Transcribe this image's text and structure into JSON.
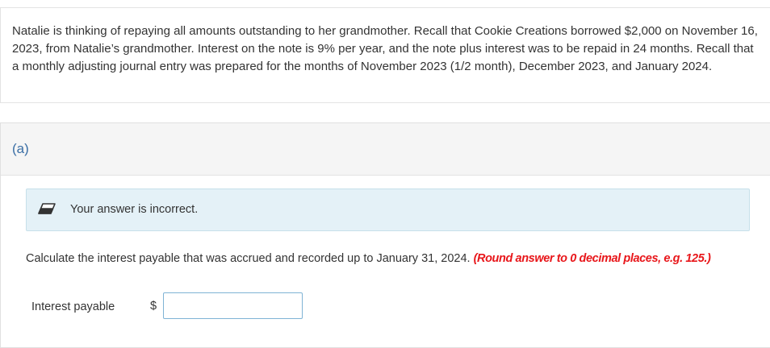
{
  "problem": {
    "text": "Natalie is thinking of repaying all amounts outstanding to her grandmother. Recall that Cookie Creations borrowed $2,000 on November 16, 2023, from Natalie’s grandmother. Interest on the note is 9% per year, and the note plus interest was to be repaid in 24 months. Recall that a monthly adjusting journal entry was prepared for the months of November 2023 (1/2 month), December 2023, and January 2024."
  },
  "part": {
    "label": "(a)",
    "feedback": {
      "icon": "eraser-icon",
      "text": "Your answer is incorrect."
    },
    "question": {
      "text": "Calculate the interest payable that was accrued and recorded up to January 31, 2024.",
      "instruction": "(Round answer to 0 decimal places, e.g. 125.)"
    },
    "field": {
      "label": "Interest payable",
      "currency": "$",
      "value": "",
      "placeholder": ""
    }
  },
  "colors": {
    "part_label": "#3a6ea5",
    "feedback_bg": "#e4f1f7",
    "instruction": "#e8161a",
    "input_border": "#7fb3d5"
  }
}
